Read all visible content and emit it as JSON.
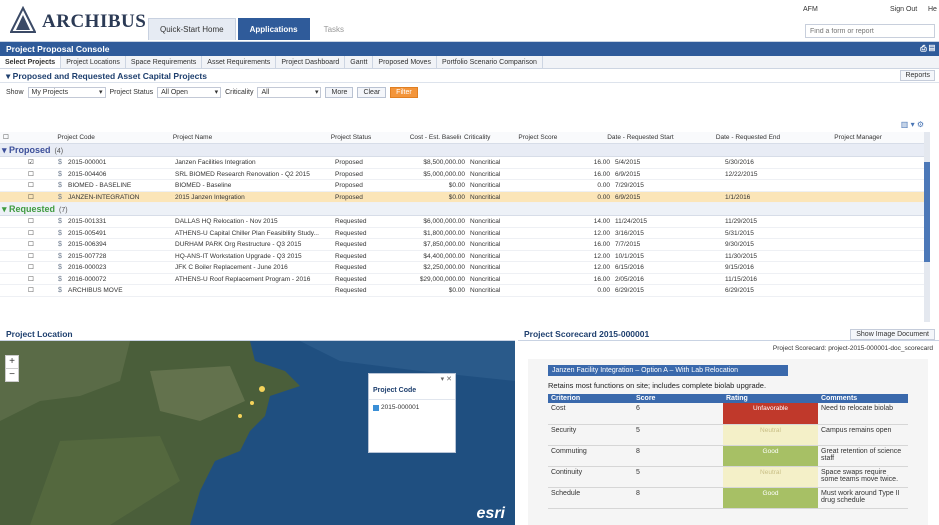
{
  "app": {
    "brand": "ARCHIBUS",
    "tabs": [
      "Quick-Start Home",
      "Applications",
      "Tasks"
    ],
    "user": "AFM",
    "sign_out": "Sign Out",
    "help": "He",
    "search_placeholder": "Find a form or report"
  },
  "console": {
    "title": "Project Proposal Console",
    "subtabs": [
      "Select Projects",
      "Project Locations",
      "Space Requirements",
      "Asset Requirements",
      "Project Dashboard",
      "Gantt",
      "Proposed Moves",
      "Portfolio Scenario Comparison"
    ]
  },
  "section": {
    "title": "Proposed and Requested Asset Capital Projects",
    "reports_label": "Reports"
  },
  "filters": {
    "show_label": "Show",
    "show_value": "My Projects",
    "status_label": "Project Status",
    "status_value": "All Open",
    "criticality_label": "Criticality",
    "criticality_value": "All",
    "more_label": "More",
    "clear_label": "Clear",
    "filter_label": "Filter"
  },
  "grid": {
    "columns": [
      "Project Code",
      "Project Name",
      "Project Status",
      "Cost - Est. Baseline",
      "Criticality",
      "Project Score",
      "Date - Requested Start",
      "Date - Requested End",
      "Project Manager"
    ],
    "groups": [
      {
        "name": "Proposed",
        "count": "(4)",
        "rows": [
          {
            "code": "2015-000001",
            "name": "Janzen Facilities Integration",
            "status": "Proposed",
            "cost": "$8,500,000.00",
            "criticality": "Noncritical",
            "score": "16.00",
            "start": "5/4/2015",
            "end": "5/30/2016"
          },
          {
            "code": "2015-004406",
            "name": "SRL BIOMED Research Renovation - Q2 2015",
            "status": "Proposed",
            "cost": "$5,000,000.00",
            "criticality": "Noncritical",
            "score": "16.00",
            "start": "6/9/2015",
            "end": "12/22/2015"
          },
          {
            "code": "BIOMED - BASELINE",
            "name": "BIOMED - Baseline",
            "status": "Proposed",
            "cost": "$0.00",
            "criticality": "Noncritical",
            "score": "0.00",
            "start": "7/29/2015",
            "end": ""
          },
          {
            "code": "JANZEN-INTEGRATION",
            "name": "2015 Janzen Integration",
            "status": "Proposed",
            "cost": "$0.00",
            "criticality": "Noncritical",
            "score": "0.00",
            "start": "6/9/2015",
            "end": "1/1/2016"
          }
        ]
      },
      {
        "name": "Requested",
        "count": "(7)",
        "rows": [
          {
            "code": "2015-001331",
            "name": "DALLAS HQ Relocation - Nov 2015",
            "status": "Requested",
            "cost": "$6,000,000.00",
            "criticality": "Noncritical",
            "score": "14.00",
            "start": "11/24/2015",
            "end": "11/29/2015"
          },
          {
            "code": "2015-005491",
            "name": "ATHENS-U Capital Chiller Plan Feasibility Study...",
            "status": "Requested",
            "cost": "$1,800,000.00",
            "criticality": "Noncritical",
            "score": "12.00",
            "start": "3/16/2015",
            "end": "5/31/2015"
          },
          {
            "code": "2015-006394",
            "name": "DURHAM PARK Org Restructure - Q3 2015",
            "status": "Requested",
            "cost": "$7,850,000.00",
            "criticality": "Noncritical",
            "score": "16.00",
            "start": "7/7/2015",
            "end": "9/30/2015"
          },
          {
            "code": "2015-007728",
            "name": "HQ-ANS-IT Workstation Upgrade - Q3 2015",
            "status": "Requested",
            "cost": "$4,400,000.00",
            "criticality": "Noncritical",
            "score": "12.00",
            "start": "10/1/2015",
            "end": "11/30/2015"
          },
          {
            "code": "2016-000023",
            "name": "JFK C Boiler Replacement - June 2016",
            "status": "Requested",
            "cost": "$2,250,000.00",
            "criticality": "Noncritical",
            "score": "12.00",
            "start": "6/15/2016",
            "end": "9/15/2016"
          },
          {
            "code": "2016-000072",
            "name": "ATHENS-U Roof Replacement Program - 2016",
            "status": "Requested",
            "cost": "$29,000,000.00",
            "criticality": "Noncritical",
            "score": "16.00",
            "start": "2/05/2016",
            "end": "11/15/2016"
          },
          {
            "code": "ARCHIBUS MOVE",
            "name": "",
            "status": "Requested",
            "cost": "$0.00",
            "criticality": "Noncritical",
            "score": "0.00",
            "start": "6/29/2015",
            "end": "6/29/2015"
          }
        ]
      }
    ]
  },
  "map_panel": {
    "title": "Project Location",
    "legend_title": "Project Code",
    "legend_item": "2015-000001",
    "esri": "esri"
  },
  "scorecard": {
    "title": "Project Scorecard 2015-000001",
    "show_image": "Show Image Document",
    "path_label": "Project Scorecard:",
    "path_value": "project-2015-000001-doc_scorecard",
    "doc_title": "Janzen Facility Integration – Option A – With Lab Relocation",
    "doc_subtitle": "Retains most functions on site; includes complete biolab upgrade.",
    "headers": [
      "Criterion",
      "Score",
      "Rating",
      "Comments"
    ],
    "rows": [
      {
        "criterion": "Cost",
        "score": "6",
        "rating": "Unfavorable",
        "color": "#c0392b",
        "comment": "Need to relocate biolab"
      },
      {
        "criterion": "Security",
        "score": "5",
        "rating": "Neutral",
        "color": "#f4f0c8",
        "comment": "Campus remains open"
      },
      {
        "criterion": "Commuting",
        "score": "8",
        "rating": "Good",
        "color": "#a7c065",
        "comment": "Great retention of science staff"
      },
      {
        "criterion": "Continuity",
        "score": "5",
        "rating": "Neutral",
        "color": "#f4f0c8",
        "comment": "Space swaps require some teams move twice."
      },
      {
        "criterion": "Schedule",
        "score": "8",
        "rating": "Good",
        "color": "#a7c065",
        "comment": "Must work around Type II drug schedule"
      }
    ]
  }
}
